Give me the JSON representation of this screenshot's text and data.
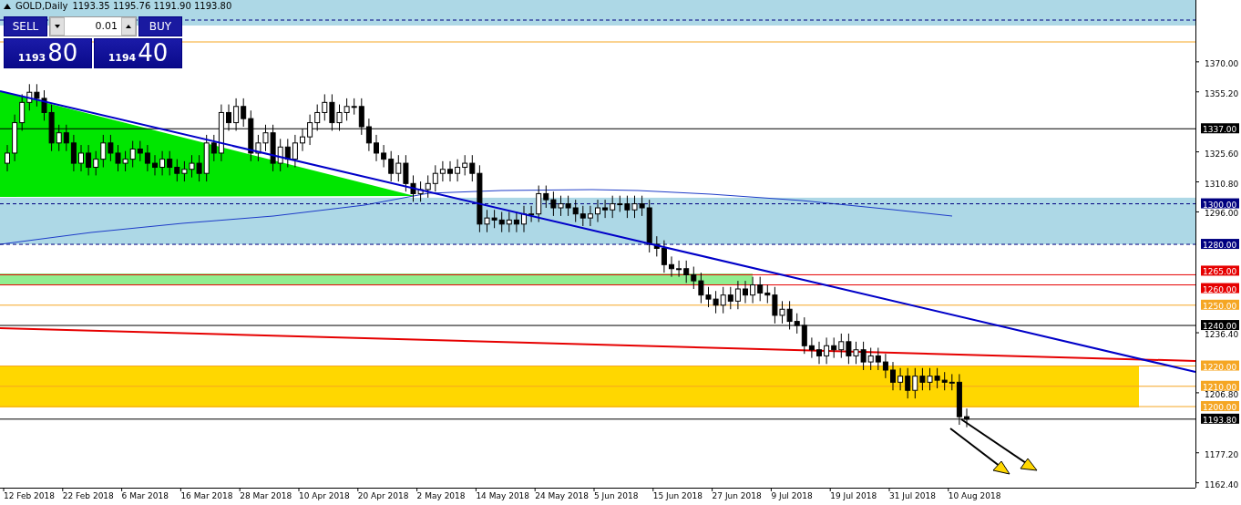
{
  "chart_header": {
    "symbol": "GOLD,Daily",
    "ohlc": "1193.35 1195.76 1191.90 1193.80"
  },
  "trade_panel": {
    "sell_label": "SELL",
    "lot": "0.01",
    "buy_label": "BUY",
    "sell_big": "1193",
    "sell_small": "80",
    "buy_big": "1194",
    "buy_small": "40"
  },
  "price_levels": [
    {
      "label": "1337.00",
      "color": "#000000"
    },
    {
      "label": "1300.00",
      "color": "#000080"
    },
    {
      "label": "1280.00",
      "color": "#000080"
    },
    {
      "label": "1265.00",
      "color": "#e60000"
    },
    {
      "label": "1260.00",
      "color": "#e60000"
    },
    {
      "label": "1250.00",
      "color": "#f5a623"
    },
    {
      "label": "1240.00",
      "color": "#000000"
    },
    {
      "label": "1220.00",
      "color": "#f5a623"
    },
    {
      "label": "1210.00",
      "color": "#f5a623"
    },
    {
      "label": "1200.00",
      "color": "#f5a623"
    },
    {
      "label": "1193.80",
      "color": "#000000"
    }
  ],
  "price_axis": [
    "1370.00",
    "1355.20",
    "1325.60",
    "1310.80",
    "1296.00",
    "1236.40",
    "1206.80",
    "1177.20",
    "1162.40"
  ],
  "date_axis": [
    "12 Feb 2018",
    "22 Feb 2018",
    "6 Mar 2018",
    "16 Mar 2018",
    "28 Mar 2018",
    "10 Apr 2018",
    "20 Apr 2018",
    "2 May 2018",
    "14 May 2018",
    "24 May 2018",
    "5 Jun 2018",
    "15 Jun 2018",
    "27 Jun 2018",
    "9 Jul 2018",
    "19 Jul 2018",
    "31 Jul 2018",
    "10 Aug 2018"
  ]
}
